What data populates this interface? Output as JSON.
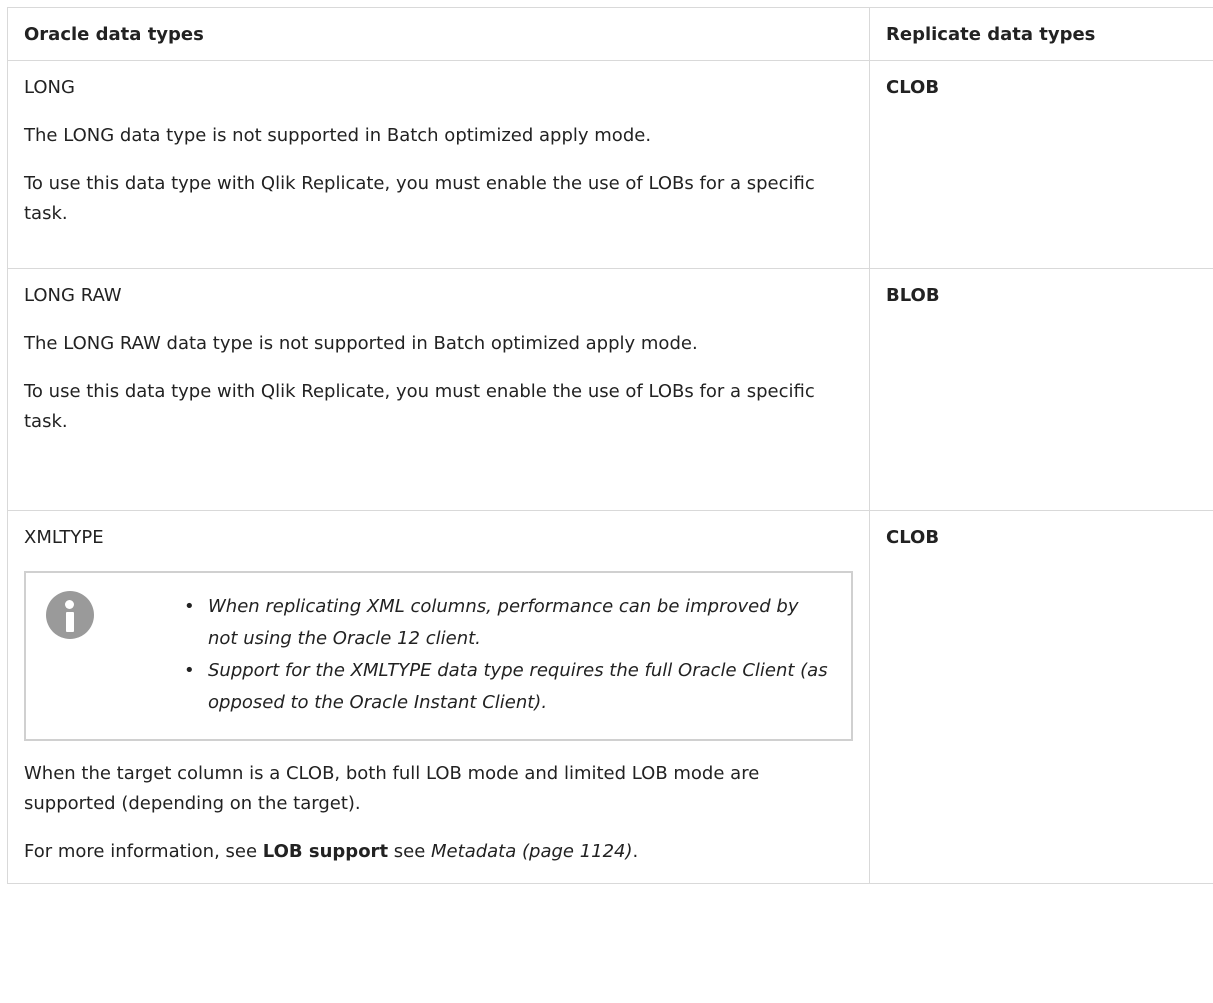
{
  "table": {
    "headers": {
      "oracle": "Oracle data types",
      "replicate": "Replicate data types"
    },
    "rows": [
      {
        "oracle_type": "LONG",
        "description": "The LONG data type is not supported in Batch optimized apply mode.",
        "note": "To use this data type with Qlik Replicate, you must enable the use of LOBs for a specific task.",
        "replicate_type": "CLOB"
      },
      {
        "oracle_type": "LONG RAW",
        "description": "The LONG RAW data type is not supported in Batch optimized apply mode.",
        "note": "To use this data type with Qlik Replicate, you must enable the use of LOBs for a specific task.",
        "replicate_type": "BLOB"
      },
      {
        "oracle_type": "XMLTYPE",
        "info_icon": "info-icon",
        "info_bullets": [
          "When replicating XML columns, performance can be improved by not using the Oracle 12 client.",
          "Support for the XMLTYPE data type requires the full Oracle Client (as opposed to the Oracle Instant Client)."
        ],
        "clob_text": "When the target column is a CLOB, both full LOB mode and limited LOB mode are supported (depending on the target).",
        "more_info_prefix": "For more information, see ",
        "more_info_bold": "LOB support",
        "more_info_mid": " see ",
        "more_info_link": "Metadata (page 1124)",
        "more_info_suffix": ".",
        "replicate_type": "CLOB"
      }
    ]
  }
}
